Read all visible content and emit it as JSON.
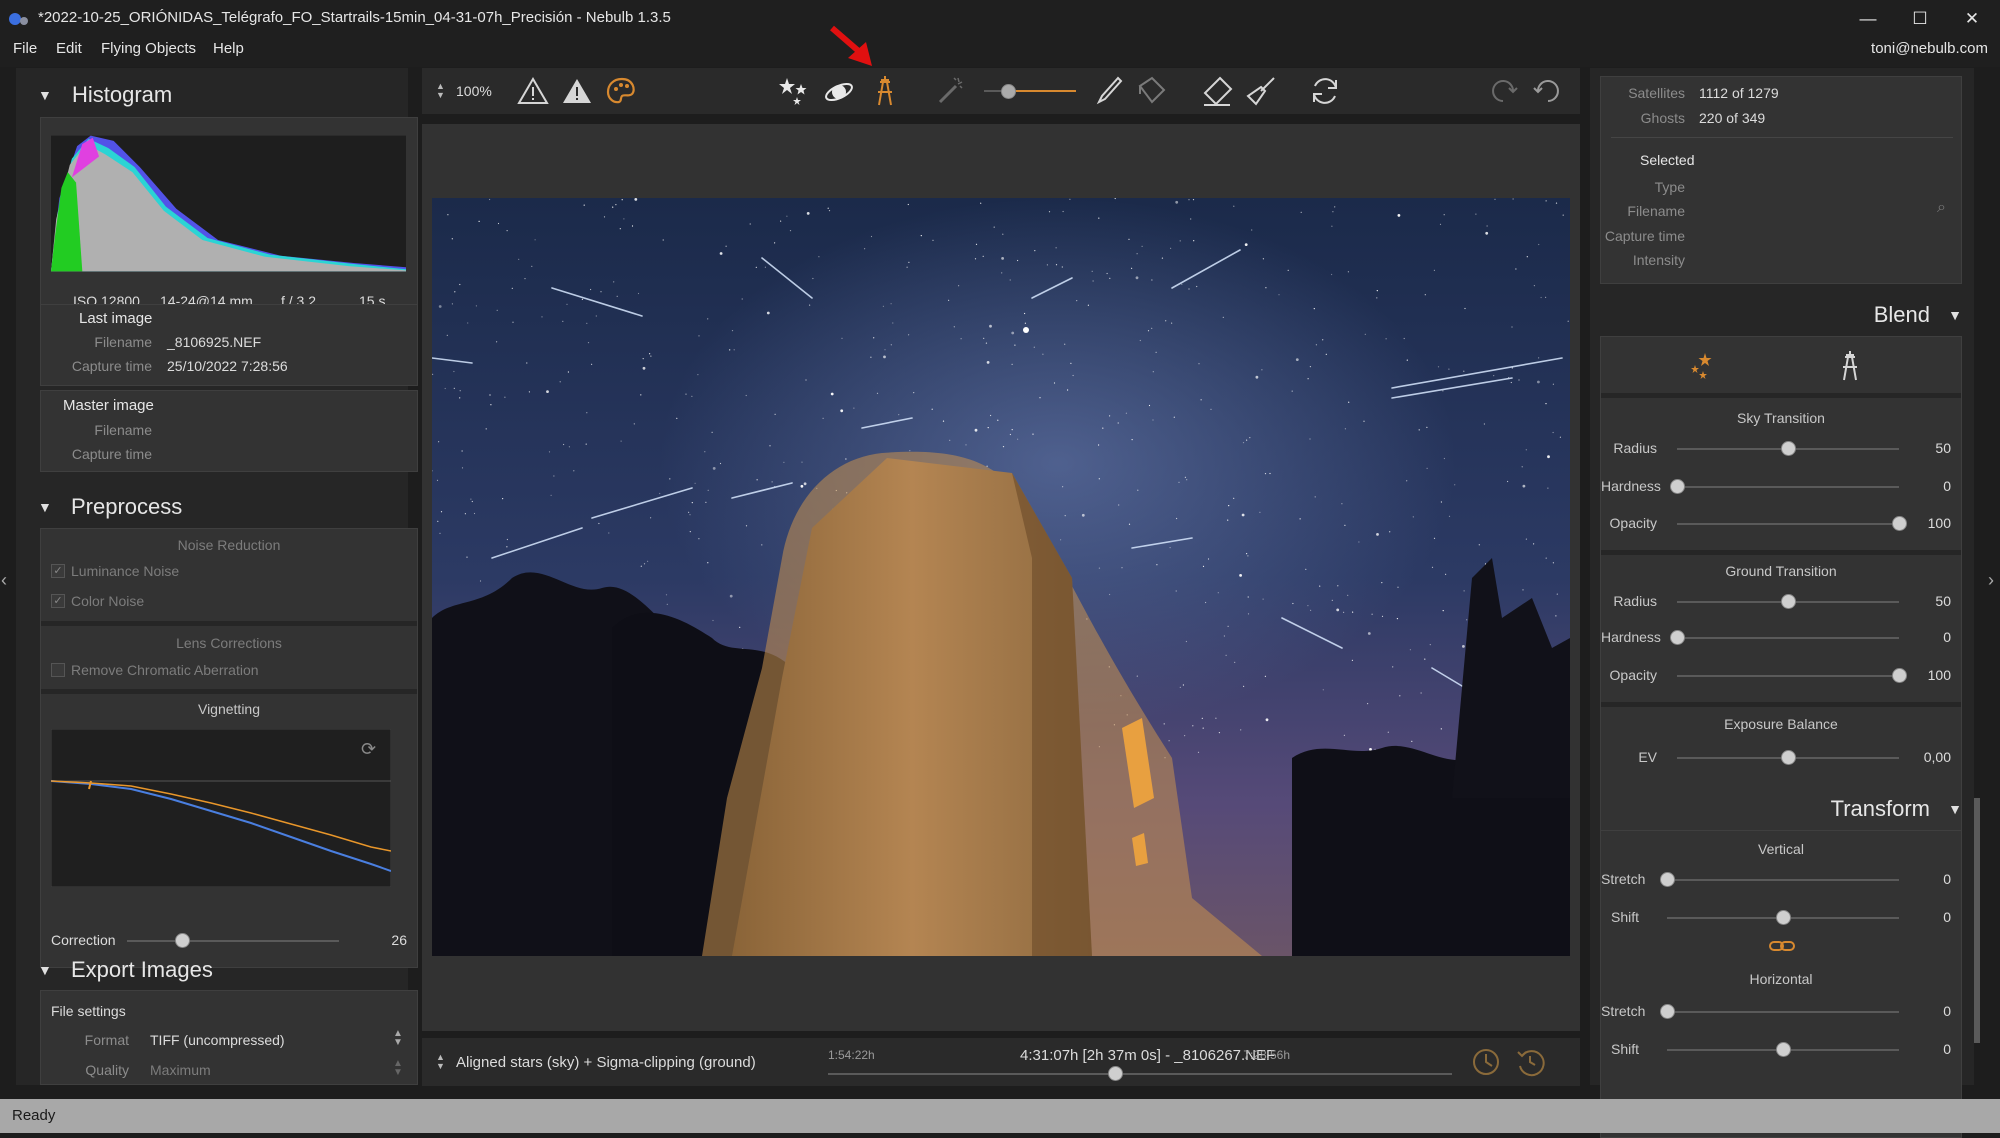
{
  "window": {
    "title": "*2022-10-25_ORIÓNIDAS_Telégrafo_FO_Startrails-15min_04-31-07h_Precisión - Nebulb 1.3.5",
    "minimize": "—",
    "maximize": "☐",
    "close": "✕"
  },
  "menu": [
    "File",
    "Edit",
    "Flying Objects",
    "Help"
  ],
  "user": "toni@nebulb.com",
  "toolbar": {
    "zoom": "100%"
  },
  "histogram": {
    "title": "Histogram",
    "iso": "ISO 12800",
    "lens": "14-24@14 mm",
    "aperture": "f / 3,2",
    "shutter": "15 s"
  },
  "last_image": {
    "title": "Last image",
    "filename_label": "Filename",
    "filename": "_8106925.NEF",
    "capture_label": "Capture time",
    "capture": "25/10/2022 7:28:56"
  },
  "master_image": {
    "title": "Master image",
    "filename_label": "Filename",
    "capture_label": "Capture time"
  },
  "preprocess": {
    "title": "Preprocess",
    "noise_reduction": "Noise Reduction",
    "luminance_noise": "Luminance Noise",
    "color_noise": "Color Noise",
    "lens_corrections": "Lens Corrections",
    "remove_ca": "Remove Chromatic Aberration",
    "vignetting": "Vignetting",
    "correction_label": "Correction",
    "correction_value": "26",
    "correction_fraction": 0.26
  },
  "export": {
    "title": "Export Images",
    "file_settings": "File settings",
    "format_label": "Format",
    "format_value": "TIFF (uncompressed)",
    "quality_label": "Quality",
    "quality_value": "Maximum"
  },
  "info": {
    "satellites_label": "Satellites",
    "satellites": "1112 of 1279",
    "ghosts_label": "Ghosts",
    "ghosts": "220 of 349",
    "selected": "Selected",
    "type_label": "Type",
    "filename_label": "Filename",
    "capture_label": "Capture time",
    "intensity_label": "Intensity"
  },
  "blend": {
    "title": "Blend",
    "sky_title": "Sky Transition",
    "ground_title": "Ground Transition",
    "exposure_title": "Exposure Balance",
    "sliders": [
      {
        "label": "Radius",
        "value": "50",
        "pos": 0.5
      },
      {
        "label": "Hardness",
        "value": "0",
        "pos": 0
      },
      {
        "label": "Opacity",
        "value": "100",
        "pos": 1
      },
      {
        "label": "Radius",
        "value": "50",
        "pos": 0.5
      },
      {
        "label": "Hardness",
        "value": "0",
        "pos": 0
      },
      {
        "label": "Opacity",
        "value": "100",
        "pos": 1
      },
      {
        "label": "EV",
        "value": "0,00",
        "pos": 0.5
      }
    ]
  },
  "transform": {
    "title": "Transform",
    "vertical": "Vertical",
    "horizontal": "Horizontal",
    "sliders": [
      {
        "label": "Stretch",
        "value": "0",
        "pos": 0
      },
      {
        "label": "Shift",
        "value": "0",
        "pos": 0.5
      },
      {
        "label": "Stretch",
        "value": "0",
        "pos": 0
      },
      {
        "label": "Shift",
        "value": "0",
        "pos": 0.5
      }
    ]
  },
  "bottom": {
    "mode": "Aligned stars (sky) + Sigma-clipping (ground)",
    "start": "1:54:22h",
    "current": "4:31:07h [2h 37m 0s] - _8106267.NEF",
    "end": "7:28:56h",
    "timeline_pos": 0.46
  },
  "status": "Ready",
  "colors": {
    "accent": "#d8892f",
    "panel": "#262626",
    "box": "#333333",
    "arrow": "#e01010"
  }
}
